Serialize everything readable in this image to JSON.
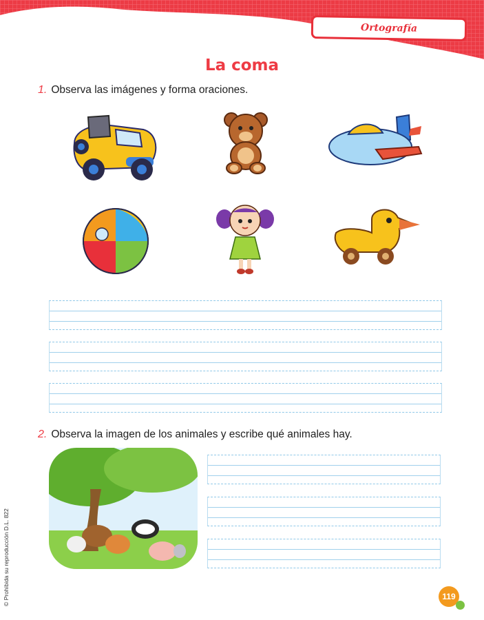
{
  "header": {
    "section_tag": "Ortografía",
    "title": "La coma"
  },
  "question1": {
    "number": "1.",
    "text": "Observa las imágenes y forma oraciones."
  },
  "question2": {
    "number": "2.",
    "text": "Observa la imagen de los animales y escribe qué animales hay."
  },
  "sidebar_note": "© Prohibida su reproducción D.L. 822",
  "page_number": "119",
  "colors": {
    "accent_red": "#ee3b44",
    "line_blue": "#8fc8e8",
    "page_orange": "#f39a1e",
    "page_green": "#7cc242"
  },
  "images": [
    "toy-car",
    "teddy-bear",
    "toy-airplane",
    "beach-ball",
    "doll",
    "wooden-duck-toy",
    "animals-under-tree"
  ]
}
